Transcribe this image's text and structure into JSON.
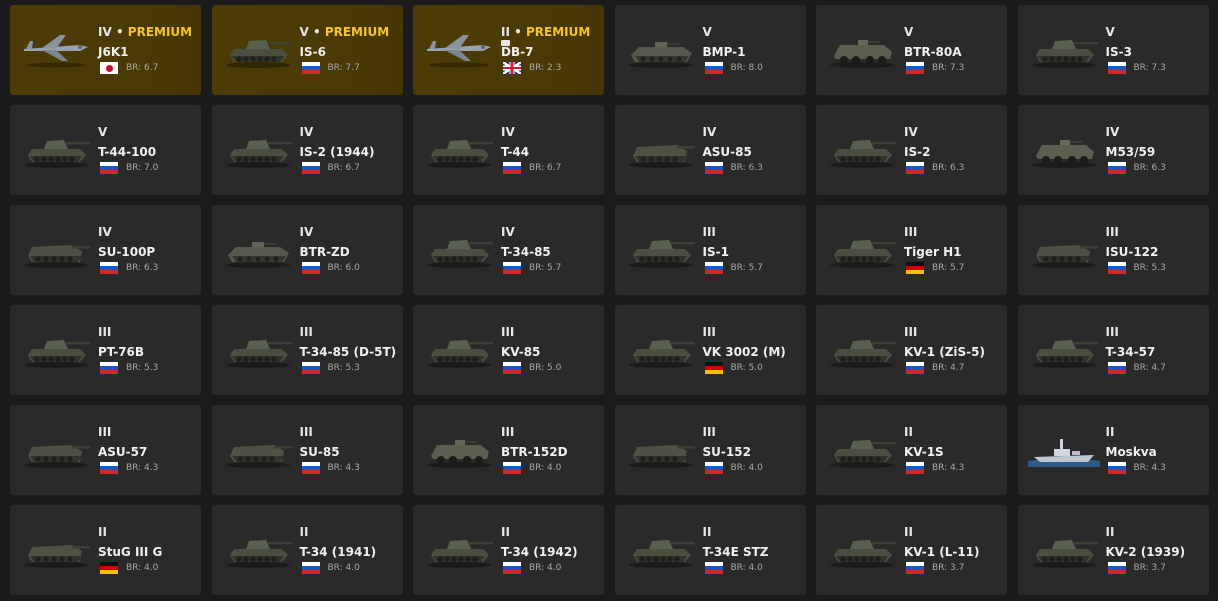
{
  "colors": {
    "background": "#1b1b1b",
    "card": "#2a2a2a",
    "premium_card": "#4b3b06",
    "premium_text": "#f6c230"
  },
  "vehicles": [
    {
      "rank": "IV",
      "premium": true,
      "premium_label": "PREMIUM",
      "name": "J6K1",
      "nation": "japan",
      "br": "BR: 6.7",
      "kind": "plane"
    },
    {
      "rank": "V",
      "premium": true,
      "premium_label": "PREMIUM",
      "name": "IS-6",
      "nation": "ussr",
      "br": "BR: 7.7",
      "kind": "tank"
    },
    {
      "rank": "II",
      "premium": true,
      "premium_label": "PREMIUM",
      "name": "DB-7",
      "nation": "uk",
      "br": "BR: 2.3",
      "kind": "plane"
    },
    {
      "rank": "V",
      "premium": false,
      "name": "BMP-1",
      "nation": "ussr",
      "br": "BR: 8.0",
      "kind": "ifv"
    },
    {
      "rank": "V",
      "premium": false,
      "name": "BTR-80A",
      "nation": "ussr",
      "br": "BR: 7.3",
      "kind": "wheeled"
    },
    {
      "rank": "V",
      "premium": false,
      "name": "IS-3",
      "nation": "ussr",
      "br": "BR: 7.3",
      "kind": "tank"
    },
    {
      "rank": "V",
      "premium": false,
      "name": "T-44-100",
      "nation": "ussr",
      "br": "BR: 7.0",
      "kind": "tank"
    },
    {
      "rank": "IV",
      "premium": false,
      "name": "IS-2 (1944)",
      "nation": "ussr",
      "br": "BR: 6.7",
      "kind": "tank"
    },
    {
      "rank": "IV",
      "premium": false,
      "name": "T-44",
      "nation": "ussr",
      "br": "BR: 6.7",
      "kind": "tank"
    },
    {
      "rank": "IV",
      "premium": false,
      "name": "ASU-85",
      "nation": "ussr",
      "br": "BR: 6.3",
      "kind": "spg"
    },
    {
      "rank": "IV",
      "premium": false,
      "name": "IS-2",
      "nation": "ussr",
      "br": "BR: 6.3",
      "kind": "tank"
    },
    {
      "rank": "IV",
      "premium": false,
      "name": "M53/59",
      "nation": "ussr",
      "br": "BR: 6.3",
      "kind": "wheeled"
    },
    {
      "rank": "IV",
      "premium": false,
      "name": "SU-100P",
      "nation": "ussr",
      "br": "BR: 6.3",
      "kind": "spg"
    },
    {
      "rank": "IV",
      "premium": false,
      "name": "BTR-ZD",
      "nation": "ussr",
      "br": "BR: 6.0",
      "kind": "ifv"
    },
    {
      "rank": "IV",
      "premium": false,
      "name": "T-34-85",
      "nation": "ussr",
      "br": "BR: 5.7",
      "kind": "tank"
    },
    {
      "rank": "III",
      "premium": false,
      "name": "IS-1",
      "nation": "ussr",
      "br": "BR: 5.7",
      "kind": "tank"
    },
    {
      "rank": "III",
      "premium": false,
      "name": "Tiger H1",
      "nation": "germany",
      "br": "BR: 5.7",
      "kind": "tank"
    },
    {
      "rank": "III",
      "premium": false,
      "name": "ISU-122",
      "nation": "ussr",
      "br": "BR: 5.3",
      "kind": "spg"
    },
    {
      "rank": "III",
      "premium": false,
      "name": "PT-76B",
      "nation": "ussr",
      "br": "BR: 5.3",
      "kind": "tank"
    },
    {
      "rank": "III",
      "premium": false,
      "name": "T-34-85 (D-5T)",
      "nation": "ussr",
      "br": "BR: 5.3",
      "kind": "tank"
    },
    {
      "rank": "III",
      "premium": false,
      "name": "KV-85",
      "nation": "ussr",
      "br": "BR: 5.0",
      "kind": "tank"
    },
    {
      "rank": "III",
      "premium": false,
      "name": "VK 3002 (M)",
      "nation": "germany",
      "br": "BR: 5.0",
      "kind": "tank"
    },
    {
      "rank": "III",
      "premium": false,
      "name": "KV-1 (ZiS-5)",
      "nation": "ussr",
      "br": "BR: 4.7",
      "kind": "tank"
    },
    {
      "rank": "III",
      "premium": false,
      "name": "T-34-57",
      "nation": "ussr",
      "br": "BR: 4.7",
      "kind": "tank"
    },
    {
      "rank": "III",
      "premium": false,
      "name": "ASU-57",
      "nation": "ussr",
      "br": "BR: 4.3",
      "kind": "spg"
    },
    {
      "rank": "III",
      "premium": false,
      "name": "SU-85",
      "nation": "ussr",
      "br": "BR: 4.3",
      "kind": "spg"
    },
    {
      "rank": "III",
      "premium": false,
      "name": "BTR-152D",
      "nation": "ussr",
      "br": "BR: 4.0",
      "kind": "wheeled"
    },
    {
      "rank": "III",
      "premium": false,
      "name": "SU-152",
      "nation": "ussr",
      "br": "BR: 4.0",
      "kind": "spg"
    },
    {
      "rank": "II",
      "premium": false,
      "name": "KV-1S",
      "nation": "ussr",
      "br": "BR: 4.3",
      "kind": "tank"
    },
    {
      "rank": "II",
      "premium": false,
      "name": "Moskva",
      "nation": "ussr",
      "br": "BR: 4.3",
      "kind": "ship"
    },
    {
      "rank": "II",
      "premium": false,
      "name": "StuG III G",
      "nation": "germany",
      "br": "BR: 4.0",
      "kind": "spg"
    },
    {
      "rank": "II",
      "premium": false,
      "name": "T-34 (1941)",
      "nation": "ussr",
      "br": "BR: 4.0",
      "kind": "tank"
    },
    {
      "rank": "II",
      "premium": false,
      "name": "T-34 (1942)",
      "nation": "ussr",
      "br": "BR: 4.0",
      "kind": "tank"
    },
    {
      "rank": "II",
      "premium": false,
      "name": "T-34E STZ",
      "nation": "ussr",
      "br": "BR: 4.0",
      "kind": "tank"
    },
    {
      "rank": "II",
      "premium": false,
      "name": "KV-1 (L-11)",
      "nation": "ussr",
      "br": "BR: 3.7",
      "kind": "tank"
    },
    {
      "rank": "II",
      "premium": false,
      "name": "KV-2 (1939)",
      "nation": "ussr",
      "br": "BR: 3.7",
      "kind": "tank"
    }
  ]
}
